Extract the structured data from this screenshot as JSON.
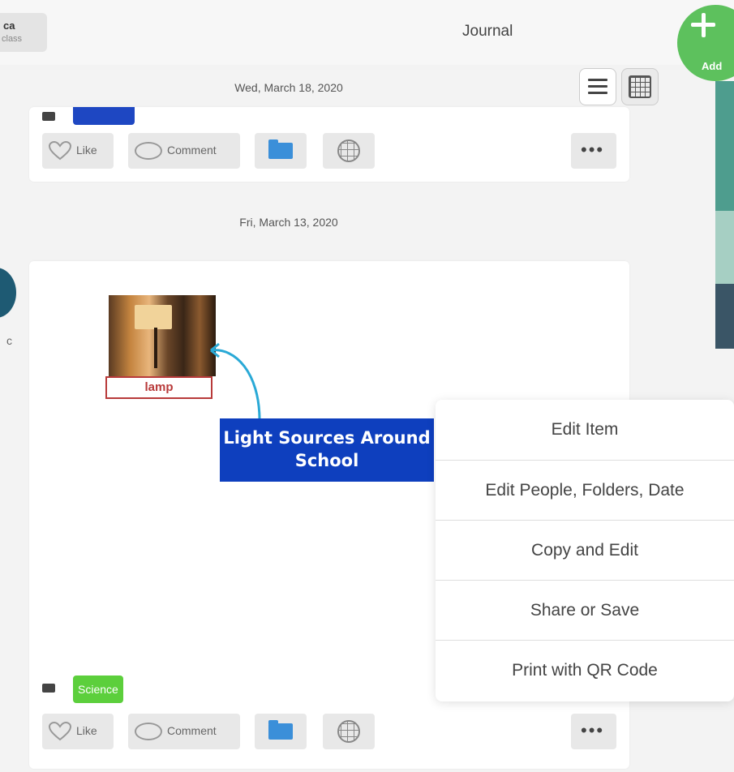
{
  "header": {
    "account_name": "ca",
    "account_sub": "class",
    "title": "Journal",
    "add_label": "Add"
  },
  "dates": {
    "first": "Wed, March 18, 2020",
    "second": "Fri, March 13, 2020"
  },
  "actions": {
    "like": "Like",
    "comment": "Comment",
    "more": "•••"
  },
  "post": {
    "photo_caption": "lamp",
    "callout_line1": "Light Sources Around",
    "callout_line2": "School",
    "folder_tag": "Science"
  },
  "side": {
    "letter": "c"
  },
  "context_menu": {
    "items": [
      "Edit Item",
      "Edit People, Folders, Date",
      "Copy and Edit",
      "Share or Save",
      "Print with QR Code"
    ]
  },
  "colors": {
    "accent_green": "#5dc15d",
    "callout_blue": "#0e3fbe",
    "folder_blue": "#3b8fd9",
    "science_green": "#5ccf3c"
  }
}
